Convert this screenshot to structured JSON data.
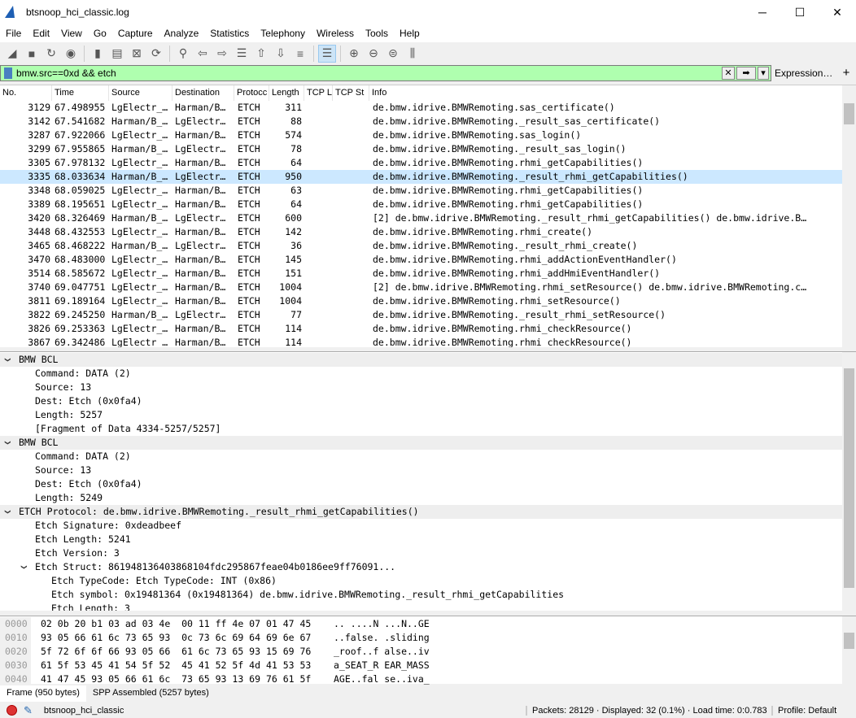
{
  "window": {
    "title": "btsnoop_hci_classic.log",
    "minimize": "─",
    "maximize": "☐",
    "close": "✕"
  },
  "menu": [
    "File",
    "Edit",
    "View",
    "Go",
    "Capture",
    "Analyze",
    "Statistics",
    "Telephony",
    "Wireless",
    "Tools",
    "Help"
  ],
  "toolbar": [
    {
      "icon": "shark-fin-start-icon",
      "glyph": "◢"
    },
    {
      "icon": "stop-icon",
      "glyph": "■"
    },
    {
      "icon": "restart-icon",
      "glyph": "↻"
    },
    {
      "icon": "capture-options-icon",
      "glyph": "◉"
    },
    {
      "icon": "open-file-icon",
      "glyph": "▮"
    },
    {
      "icon": "save-file-icon",
      "glyph": "▤"
    },
    {
      "icon": "close-file-icon",
      "glyph": "⊠"
    },
    {
      "icon": "reload-icon",
      "glyph": "⟳"
    },
    {
      "icon": "find-icon",
      "glyph": "⚲"
    },
    {
      "icon": "go-back-icon",
      "glyph": "⇦"
    },
    {
      "icon": "go-forward-icon",
      "glyph": "⇨"
    },
    {
      "icon": "go-to-packet-icon",
      "glyph": "☰"
    },
    {
      "icon": "first-packet-icon",
      "glyph": "⇧"
    },
    {
      "icon": "last-packet-icon",
      "glyph": "⇩"
    },
    {
      "icon": "autoscroll-icon",
      "glyph": "≡"
    },
    {
      "icon": "colorize-icon",
      "glyph": "☰"
    },
    {
      "icon": "zoom-in-icon",
      "glyph": "⊕"
    },
    {
      "icon": "zoom-out-icon",
      "glyph": "⊖"
    },
    {
      "icon": "zoom-normal-icon",
      "glyph": "⊜"
    },
    {
      "icon": "resize-columns-icon",
      "glyph": "⫼"
    }
  ],
  "filter": {
    "value": "bmw.src==0xd && etch",
    "expression_label": "Expression…",
    "add_label": "+",
    "clear": "✕",
    "apply": "➡",
    "dropdown": "▾",
    "bg_color": "#afffaf"
  },
  "columns": [
    "No.",
    "Time",
    "Source",
    "Destination",
    "Protocc",
    "Length",
    "TCP L",
    "TCP St",
    "Info"
  ],
  "packets": [
    [
      "3129",
      "67.498955",
      "LgElectr_…",
      "Harman/B…",
      "ETCH",
      "311",
      "de.bmw.idrive.BMWRemoting.sas_certificate()"
    ],
    [
      "3142",
      "67.541682",
      "Harman/B_…",
      "LgElectr…",
      "ETCH",
      "88",
      "de.bmw.idrive.BMWRemoting._result_sas_certificate()"
    ],
    [
      "3287",
      "67.922066",
      "LgElectr_…",
      "Harman/B…",
      "ETCH",
      "574",
      "de.bmw.idrive.BMWRemoting.sas_login()"
    ],
    [
      "3299",
      "67.955865",
      "Harman/B_…",
      "LgElectr…",
      "ETCH",
      "78",
      "de.bmw.idrive.BMWRemoting._result_sas_login()"
    ],
    [
      "3305",
      "67.978132",
      "LgElectr_…",
      "Harman/B…",
      "ETCH",
      "64",
      "de.bmw.idrive.BMWRemoting.rhmi_getCapabilities()"
    ],
    [
      "3335",
      "68.033634",
      "Harman/B_…",
      "LgElectr…",
      "ETCH",
      "950",
      "de.bmw.idrive.BMWRemoting._result_rhmi_getCapabilities()"
    ],
    [
      "3348",
      "68.059025",
      "LgElectr_…",
      "Harman/B…",
      "ETCH",
      "63",
      "de.bmw.idrive.BMWRemoting.rhmi_getCapabilities()"
    ],
    [
      "3389",
      "68.195651",
      "LgElectr_…",
      "Harman/B…",
      "ETCH",
      "64",
      "de.bmw.idrive.BMWRemoting.rhmi_getCapabilities()"
    ],
    [
      "3420",
      "68.326469",
      "Harman/B_…",
      "LgElectr…",
      "ETCH",
      "600",
      "[2] de.bmw.idrive.BMWRemoting._result_rhmi_getCapabilities() de.bmw.idrive.B…"
    ],
    [
      "3448",
      "68.432553",
      "LgElectr_…",
      "Harman/B…",
      "ETCH",
      "142",
      "de.bmw.idrive.BMWRemoting.rhmi_create()"
    ],
    [
      "3465",
      "68.468222",
      "Harman/B_…",
      "LgElectr…",
      "ETCH",
      "36",
      "de.bmw.idrive.BMWRemoting._result_rhmi_create()"
    ],
    [
      "3470",
      "68.483000",
      "LgElectr_…",
      "Harman/B…",
      "ETCH",
      "145",
      "de.bmw.idrive.BMWRemoting.rhmi_addActionEventHandler()"
    ],
    [
      "3514",
      "68.585672",
      "LgElectr_…",
      "Harman/B…",
      "ETCH",
      "151",
      "de.bmw.idrive.BMWRemoting.rhmi_addHmiEventHandler()"
    ],
    [
      "3740",
      "69.047751",
      "LgElectr_…",
      "Harman/B…",
      "ETCH",
      "1004",
      "[2] de.bmw.idrive.BMWRemoting.rhmi_setResource() de.bmw.idrive.BMWRemoting.c…"
    ],
    [
      "3811",
      "69.189164",
      "LgElectr_…",
      "Harman/B…",
      "ETCH",
      "1004",
      "de.bmw.idrive.BMWRemoting.rhmi_setResource()"
    ],
    [
      "3822",
      "69.245250",
      "Harman/B_…",
      "LgElectr…",
      "ETCH",
      "77",
      "de.bmw.idrive.BMWRemoting._result_rhmi_setResource()"
    ],
    [
      "3826",
      "69.253363",
      "LgElectr_…",
      "Harman/B…",
      "ETCH",
      "114",
      "de.bmw.idrive.BMWRemoting.rhmi_checkResource()"
    ],
    [
      "3867",
      "69.342486",
      "LgElectr_…",
      "Harman/B…",
      "ETCH",
      "114",
      "de.bmw.idrive.BMWRemoting.rhmi_checkResource()"
    ]
  ],
  "selected_packet": "3335",
  "details": [
    {
      "level": 0,
      "expanded": true,
      "text": "BMW BCL"
    },
    {
      "level": 1,
      "text": "Command: DATA (2)"
    },
    {
      "level": 1,
      "text": "Source: 13"
    },
    {
      "level": 1,
      "text": "Dest: Etch (0x0fa4)"
    },
    {
      "level": 1,
      "text": "Length: 5257"
    },
    {
      "level": 1,
      "text": "[Fragment of Data 4334-5257/5257]"
    },
    {
      "level": 0,
      "expanded": true,
      "text": "BMW BCL"
    },
    {
      "level": 1,
      "text": "Command: DATA (2)"
    },
    {
      "level": 1,
      "text": "Source: 13"
    },
    {
      "level": 1,
      "text": "Dest: Etch (0x0fa4)"
    },
    {
      "level": 1,
      "text": "Length: 5249"
    },
    {
      "level": 0,
      "expanded": true,
      "text": "ETCH Protocol: de.bmw.idrive.BMWRemoting._result_rhmi_getCapabilities()"
    },
    {
      "level": 1,
      "text": "Etch Signature: 0xdeadbeef"
    },
    {
      "level": 1,
      "text": "Etch Length: 5241"
    },
    {
      "level": 1,
      "text": "Etch Version: 3"
    },
    {
      "level": 1,
      "expanded": true,
      "text": "Etch Struct: 861948136403868104fdc295867feae04b0186ee9ff76091..."
    },
    {
      "level": 2,
      "text": "Etch TypeCode: Etch TypeCode: INT (0x86)"
    },
    {
      "level": 2,
      "text": "Etch symbol: 0x19481364 (0x19481364) de.bmw.idrive.BMWRemoting._result_rhmi_getCapabilities"
    },
    {
      "level": 2,
      "text": "Etch Length: 3"
    }
  ],
  "hex": [
    [
      "0000",
      "02 0b 20 b1 03 ad 03 4e  00 11 ff 4e 07 01 47 45",
      ".. ....N ...N..GE"
    ],
    [
      "0010",
      "93 05 66 61 6c 73 65 93  0c 73 6c 69 64 69 6e 67",
      "..false. .sliding"
    ],
    [
      "0020",
      "5f 72 6f 6f 66 93 05 66  61 6c 73 65 93 15 69 76",
      "_roof..f alse..iv"
    ],
    [
      "0030",
      "61 5f 53 45 41 54 5f 52  45 41 52 5f 4d 41 53 53",
      "a_SEAT_R EAR_MASS"
    ],
    [
      "0040",
      "41 47 45 93 05 66 61 6c  73 65 93 13 69 76 61 5f",
      "AGE..fal se..iva_"
    ]
  ],
  "bytes_tabs": [
    "Frame (950 bytes)",
    "SPP Assembled (5257 bytes)"
  ],
  "status": {
    "file": "btsnoop_hci_classic",
    "packets": "Packets: 28129 · Displayed: 32 (0.1%) · Load time: 0:0.783",
    "profile": "Profile: Default"
  }
}
